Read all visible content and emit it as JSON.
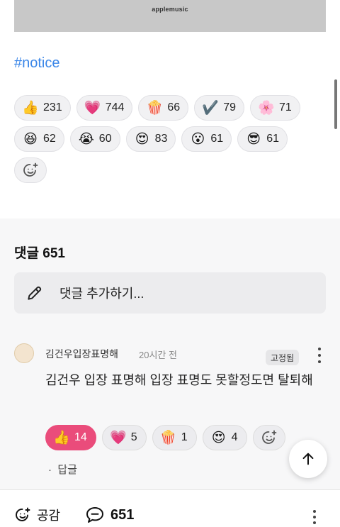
{
  "banner": {
    "logo_text": "applemusic"
  },
  "post": {
    "hashtag": "#notice"
  },
  "reactions": [
    {
      "icon": "thumbs-up-icon",
      "glyph": "👍",
      "count": "231"
    },
    {
      "icon": "heart-icon",
      "glyph": "💗",
      "count": "744"
    },
    {
      "icon": "popcorn-icon",
      "glyph": "🍿",
      "count": "66"
    },
    {
      "icon": "check-mark-icon",
      "glyph": "✔️",
      "count": "79"
    },
    {
      "icon": "flower-icon",
      "glyph": "🌸",
      "count": "71"
    },
    {
      "icon": "laughing-face-icon",
      "glyph": "😆",
      "count": "62"
    },
    {
      "icon": "crying-face-icon",
      "glyph": "😭",
      "count": "60"
    },
    {
      "icon": "heart-eyes-face-icon",
      "glyph": "😍",
      "count": "83"
    },
    {
      "icon": "surprised-face-icon",
      "glyph": "😮",
      "count": "61"
    },
    {
      "icon": "sunglasses-face-icon",
      "glyph": "😎",
      "count": "61"
    }
  ],
  "comments": {
    "title": "댓글",
    "count": "651",
    "input_placeholder": "댓글 추가하기...",
    "items": [
      {
        "author": "김건우입장표명해",
        "time": "20시간 전",
        "pinned_label": "고정됨",
        "text": "김건우 입장 표명해 입장 표명도 못할정도면 탈퇴해",
        "reactions": [
          {
            "icon": "thumbs-up-icon",
            "glyph": "👍",
            "count": "14",
            "active": true
          },
          {
            "icon": "heart-icon",
            "glyph": "💗",
            "count": "5",
            "active": false
          },
          {
            "icon": "popcorn-icon",
            "glyph": "🍿",
            "count": "1",
            "active": false
          },
          {
            "icon": "heart-eyes-face-icon",
            "glyph": "😍",
            "count": "4",
            "active": false
          }
        ],
        "reply_label": "답글"
      }
    ]
  },
  "bottom_bar": {
    "like_label": "공감",
    "comment_count": "651"
  },
  "colors": {
    "accent_link": "#3a86e8",
    "active_reaction": "#ea4c7b"
  }
}
